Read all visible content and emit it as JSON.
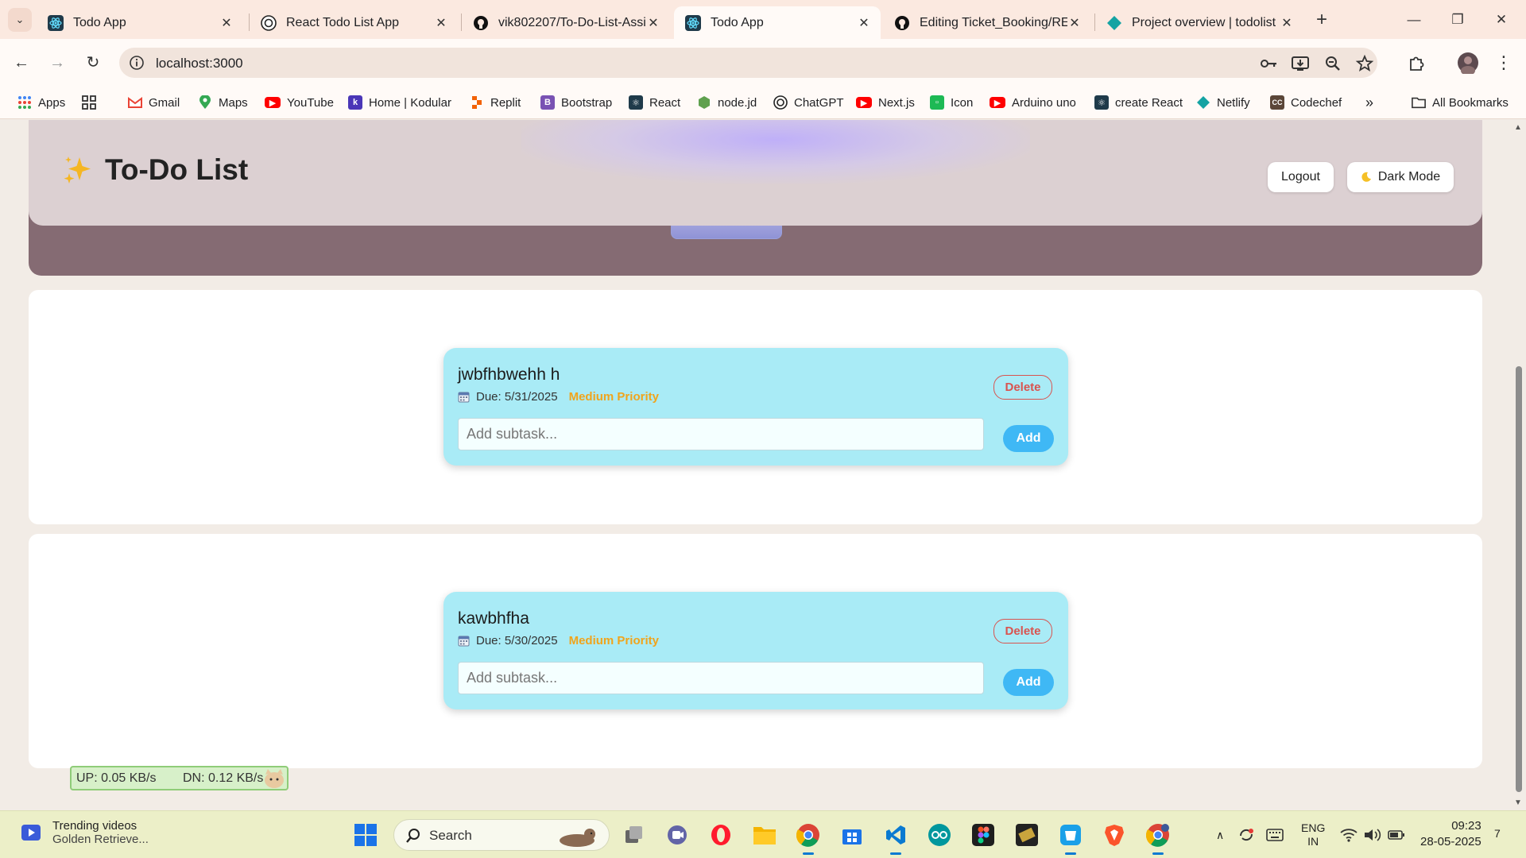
{
  "browser": {
    "tabs": [
      {
        "title": "Todo App",
        "active": false
      },
      {
        "title": "React Todo List App",
        "active": false
      },
      {
        "title": "vik802207/To-Do-List-Assi",
        "active": false
      },
      {
        "title": "Todo App",
        "active": true
      },
      {
        "title": "Editing Ticket_Booking/RE",
        "active": false
      },
      {
        "title": "Project overview | todolist",
        "active": false
      }
    ],
    "url": "localhost:3000",
    "bookmarks": [
      "Apps",
      "Gmail",
      "Maps",
      "YouTube",
      "Home | Kodular",
      "Replit",
      "Bootstrap",
      "React",
      "node.jd",
      "ChatGPT",
      "Next.js",
      "Icon",
      "Arduino uno",
      "create React",
      "Netlify",
      "Codechef"
    ],
    "all_bookmarks": "All Bookmarks"
  },
  "header": {
    "title": "To-Do List",
    "logout_label": "Logout",
    "dark_mode_label": "Dark Mode"
  },
  "todos": [
    {
      "title": "jwbfhbwehh h",
      "due": "Due: 5/31/2025",
      "priority": "Medium Priority",
      "delete_label": "Delete",
      "subtask_placeholder": "Add subtask...",
      "add_label": "Add"
    },
    {
      "title": "kawbhfha",
      "due": "Due: 5/30/2025",
      "priority": "Medium Priority",
      "delete_label": "Delete",
      "subtask_placeholder": "Add subtask...",
      "add_label": "Add"
    }
  ],
  "netmonitor": {
    "up": "UP: 0.05 KB/s",
    "dn": "DN: 0.12 KB/s"
  },
  "taskbar": {
    "news_title": "Trending videos",
    "news_sub": "Golden Retrieve...",
    "search_label": "Search",
    "lang1": "ENG",
    "lang2": "IN",
    "time": "09:23",
    "date": "28-05-2025",
    "notification_count": "7"
  },
  "colors": {
    "accent": "#3fb8f5",
    "danger": "#d9534f",
    "priority_medium": "#f0a41c",
    "card": "#a9ebf6"
  }
}
